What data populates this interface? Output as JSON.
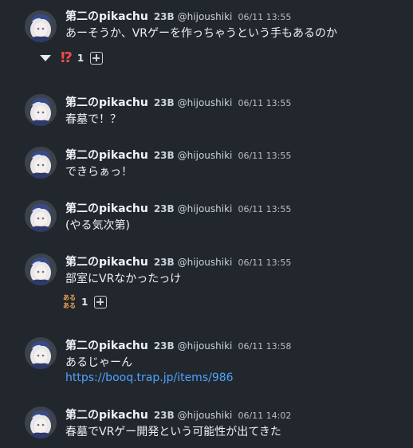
{
  "messages": [
    {
      "author": "第二のpikachu",
      "grade": "23B",
      "handle": "@hijoushiki",
      "time": "06/11 13:55",
      "text": "あーそうか、VRゲーを作っちゃうという手もあるのか"
    },
    {
      "author": "第二のpikachu",
      "grade": "23B",
      "handle": "@hijoushiki",
      "time": "06/11 13:55",
      "text": "春墓で！？"
    },
    {
      "author": "第二のpikachu",
      "grade": "23B",
      "handle": "@hijoushiki",
      "time": "06/11 13:55",
      "text": "できらぁっ！"
    },
    {
      "author": "第二のpikachu",
      "grade": "23B",
      "handle": "@hijoushiki",
      "time": "06/11 13:55",
      "text": "(やる気次第)"
    },
    {
      "author": "第二のpikachu",
      "grade": "23B",
      "handle": "@hijoushiki",
      "time": "06/11 13:55",
      "text": "部室にVRなかったっけ"
    },
    {
      "author": "第二のpikachu",
      "grade": "23B",
      "handle": "@hijoushiki",
      "time": "06/11 13:58",
      "text": "あるじゃーん",
      "link": "https://booq.trap.jp/items/986"
    },
    {
      "author": "第二のpikachu",
      "grade": "23B",
      "handle": "@hijoushiki",
      "time": "06/11 14:02",
      "text": "春墓でVRゲー開発という可能性が出てきた"
    }
  ],
  "reactions": {
    "message1": {
      "stamp": "⁉",
      "count": "1",
      "icon": "exclamation-question-stamp"
    },
    "message5": {
      "stamp": "ある ある",
      "count": "1",
      "icon": "aruaru-stamp"
    }
  },
  "colors": {
    "background": "#22272e",
    "link": "#4da3ff"
  }
}
